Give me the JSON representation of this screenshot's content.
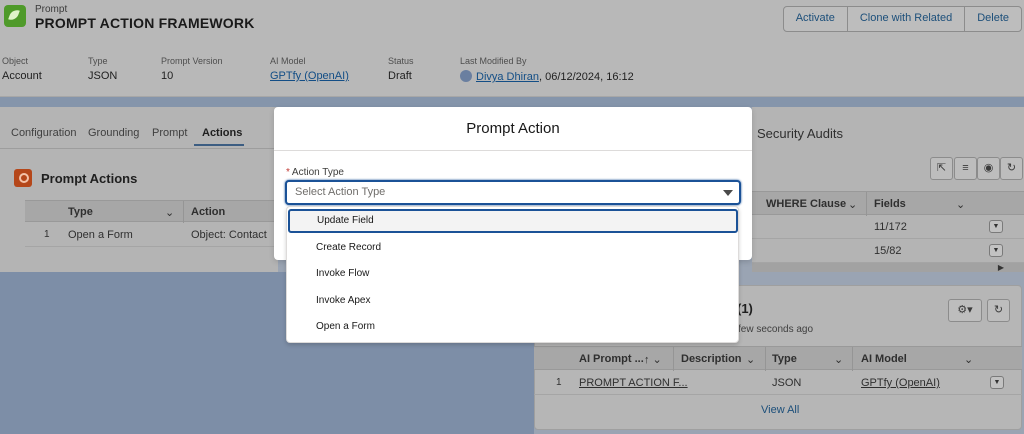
{
  "record": {
    "object_label": "Prompt",
    "title": "PROMPT ACTION FRAMEWORK",
    "buttons": [
      "Activate",
      "Clone with Related",
      "Delete"
    ],
    "fields": [
      {
        "label": "Object",
        "value": "Account"
      },
      {
        "label": "Type",
        "value": "JSON"
      },
      {
        "label": "Prompt Version",
        "value": "10"
      },
      {
        "label": "AI Model",
        "value": "GPTfy (OpenAI)"
      },
      {
        "label": "Status",
        "value": "Draft"
      },
      {
        "label": "Last Modified By",
        "value": "Divya Dhiran",
        "suffix": ", 06/12/2024, 16:12"
      }
    ]
  },
  "tabs": [
    "Configuration",
    "Grounding",
    "Prompt",
    "Actions"
  ],
  "active_tab": "Actions",
  "prompt_actions": {
    "title": "Prompt Actions",
    "columns": [
      "Type",
      "Action"
    ],
    "rows": [
      {
        "num": "1",
        "type": "Open a Form",
        "action": "Object: Contact"
      }
    ]
  },
  "security_audits": {
    "tab_label": "Security Audits",
    "columns": [
      "WHERE Clause",
      "Fields"
    ],
    "rows": [
      {
        "fields": "11/172"
      },
      {
        "fields": "15/82"
      }
    ]
  },
  "related": {
    "title": "(1)",
    "subtitle": "few seconds ago",
    "columns": [
      "AI Prompt ...",
      "Description",
      "Type",
      "AI Model"
    ],
    "rows": [
      {
        "num": "1",
        "name": "PROMPT ACTION F...",
        "description": "",
        "type": "JSON",
        "ai_model": "GPTfy (OpenAI)"
      }
    ],
    "view_all": "View All"
  },
  "modal": {
    "title": "Prompt Action",
    "field_label": "Action Type",
    "required_marker": "*",
    "placeholder": "Select Action Type",
    "options": [
      "Update Field",
      "Create Record",
      "Invoke Flow",
      "Invoke Apex",
      "Open a Form"
    ],
    "focused_option": "Update Field"
  },
  "colors": {
    "accent": "#1b5297",
    "link": "#134e86",
    "overlay": "#7d8ea7"
  }
}
